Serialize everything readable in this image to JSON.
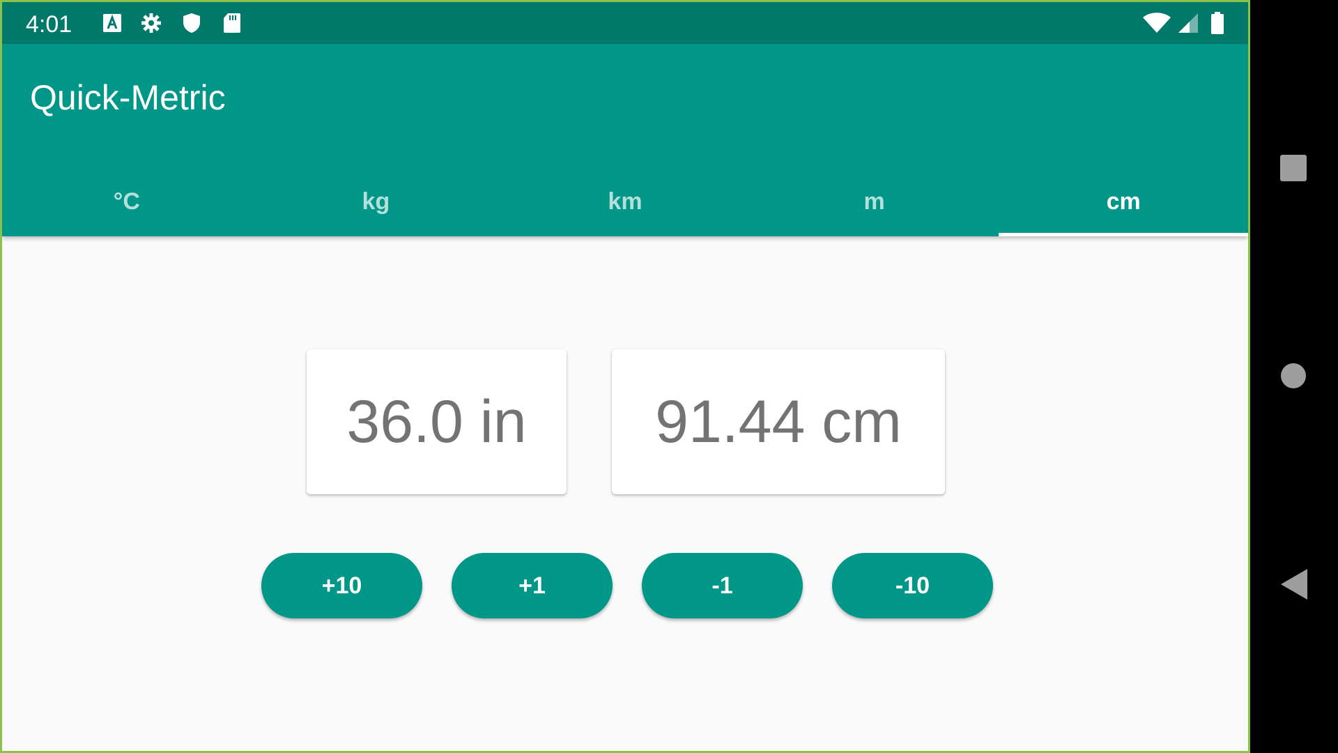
{
  "status_bar": {
    "time": "4:01",
    "icons": [
      "text-a-icon",
      "settings-gear-icon",
      "shield-icon",
      "sd-card-icon",
      "wifi-icon",
      "cell-signal-icon",
      "battery-icon"
    ]
  },
  "app": {
    "title": "Quick-Metric"
  },
  "tabs": [
    {
      "label": "°C",
      "active": false
    },
    {
      "label": "kg",
      "active": false
    },
    {
      "label": "km",
      "active": false
    },
    {
      "label": "m",
      "active": false
    },
    {
      "label": "cm",
      "active": true
    }
  ],
  "conversion": {
    "input_value": "36.0 in",
    "output_value": "91.44 cm"
  },
  "buttons": {
    "plus_ten": "+10",
    "plus_one": "+1",
    "minus_one": "-1",
    "minus_ten": "-10"
  },
  "nav_bar": {
    "icons": [
      "recents-square-icon",
      "home-circle-icon",
      "back-triangle-icon"
    ]
  },
  "colors": {
    "primary": "#009688",
    "primary_dark": "#00796b",
    "background": "#fafafa",
    "value_text": "#737373"
  }
}
